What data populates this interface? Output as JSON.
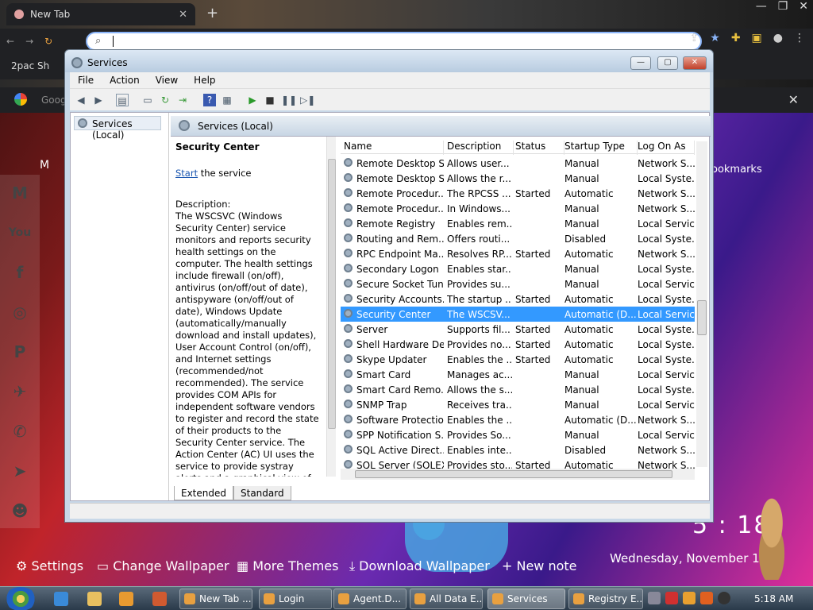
{
  "browser": {
    "tab_title": "New Tab",
    "tab_close": "✕",
    "new_tab_plus": "+",
    "bookmark_first": "2pac Sh",
    "google_partial": "Goog",
    "bookmarks_label": "ookmarks",
    "m_partial": "M"
  },
  "desktop": {
    "settings": "Settings",
    "change_wallpaper": "Change Wallpaper",
    "more_themes": "More Themes",
    "download_wallpaper": "Download Wallpaper",
    "new_note": "+ New note",
    "clock": "5 : 18",
    "date": "Wednesday, November 1"
  },
  "taskbar": {
    "items": [
      {
        "label": "New Tab ..."
      },
      {
        "label": "Login"
      },
      {
        "label": "Agent.D..."
      },
      {
        "label": "All Data E..."
      },
      {
        "label": "Services"
      },
      {
        "label": "Registry E..."
      }
    ],
    "time": "5:18 AM"
  },
  "services_window": {
    "title": "Services",
    "menu": [
      "File",
      "Action",
      "View",
      "Help"
    ],
    "tree_item": "Services (Local)",
    "header": "Services (Local)",
    "detail": {
      "title": "Security Center",
      "start_link": "Start",
      "start_suffix": " the service",
      "desc_label": "Description:",
      "desc_text": "The WSCSVC (Windows Security Center) service monitors and reports security health settings on the computer.  The health settings include firewall (on/off), antivirus (on/off/out of date), antispyware (on/off/out of date), Windows Update (automatically/manually download and install updates), User Account Control (on/off), and Internet settings (recommended/not recommended). The service provides COM APIs for independent software vendors to register and record the state of their products to the Security Center service.  The Action Center (AC) UI uses the service to provide systray alerts and a graphical view of the security health states in the AC control panel.  Network Access Protection (NAP) uses the service"
    },
    "columns": [
      "Name",
      "Description",
      "Status",
      "Startup Type",
      "Log On As"
    ],
    "rows": [
      {
        "name": "Remote Desktop S...",
        "desc": "Allows user...",
        "status": "",
        "startup": "Manual",
        "logon": "Network S..."
      },
      {
        "name": "Remote Desktop S...",
        "desc": "Allows the r...",
        "status": "",
        "startup": "Manual",
        "logon": "Local Syste..."
      },
      {
        "name": "Remote Procedur...",
        "desc": "The RPCSS ...",
        "status": "Started",
        "startup": "Automatic",
        "logon": "Network S..."
      },
      {
        "name": "Remote Procedur...",
        "desc": "In Windows...",
        "status": "",
        "startup": "Manual",
        "logon": "Network S..."
      },
      {
        "name": "Remote Registry",
        "desc": "Enables rem...",
        "status": "",
        "startup": "Manual",
        "logon": "Local Service"
      },
      {
        "name": "Routing and Rem...",
        "desc": "Offers routi...",
        "status": "",
        "startup": "Disabled",
        "logon": "Local Syste..."
      },
      {
        "name": "RPC Endpoint Ma...",
        "desc": "Resolves RP...",
        "status": "Started",
        "startup": "Automatic",
        "logon": "Network S..."
      },
      {
        "name": "Secondary Logon",
        "desc": "Enables star...",
        "status": "",
        "startup": "Manual",
        "logon": "Local Syste..."
      },
      {
        "name": "Secure Socket Tun...",
        "desc": "Provides su...",
        "status": "",
        "startup": "Manual",
        "logon": "Local Service"
      },
      {
        "name": "Security Accounts...",
        "desc": "The startup ...",
        "status": "Started",
        "startup": "Automatic",
        "logon": "Local Syste..."
      },
      {
        "name": "Security Center",
        "desc": "The WSCSV...",
        "status": "",
        "startup": "Automatic (D...",
        "logon": "Local Service"
      },
      {
        "name": "Server",
        "desc": "Supports fil...",
        "status": "Started",
        "startup": "Automatic",
        "logon": "Local Syste..."
      },
      {
        "name": "Shell Hardware De...",
        "desc": "Provides no...",
        "status": "Started",
        "startup": "Automatic",
        "logon": "Local Syste..."
      },
      {
        "name": "Skype Updater",
        "desc": "Enables the ...",
        "status": "Started",
        "startup": "Automatic",
        "logon": "Local Syste..."
      },
      {
        "name": "Smart Card",
        "desc": "Manages ac...",
        "status": "",
        "startup": "Manual",
        "logon": "Local Service"
      },
      {
        "name": "Smart Card Remo...",
        "desc": "Allows the s...",
        "status": "",
        "startup": "Manual",
        "logon": "Local Syste..."
      },
      {
        "name": "SNMP Trap",
        "desc": "Receives tra...",
        "status": "",
        "startup": "Manual",
        "logon": "Local Service"
      },
      {
        "name": "Software Protection",
        "desc": "Enables the ...",
        "status": "",
        "startup": "Automatic (D...",
        "logon": "Network S..."
      },
      {
        "name": "SPP Notification S...",
        "desc": "Provides So...",
        "status": "",
        "startup": "Manual",
        "logon": "Local Service"
      },
      {
        "name": "SQL Active Direct...",
        "desc": "Enables inte...",
        "status": "",
        "startup": "Disabled",
        "logon": "Network S..."
      },
      {
        "name": "SQL Server (SQLEX...",
        "desc": "Provides sto...",
        "status": "Started",
        "startup": "Automatic",
        "logon": "Network S..."
      }
    ],
    "selected_index": 10,
    "tabs": [
      "Extended",
      "Standard"
    ]
  }
}
